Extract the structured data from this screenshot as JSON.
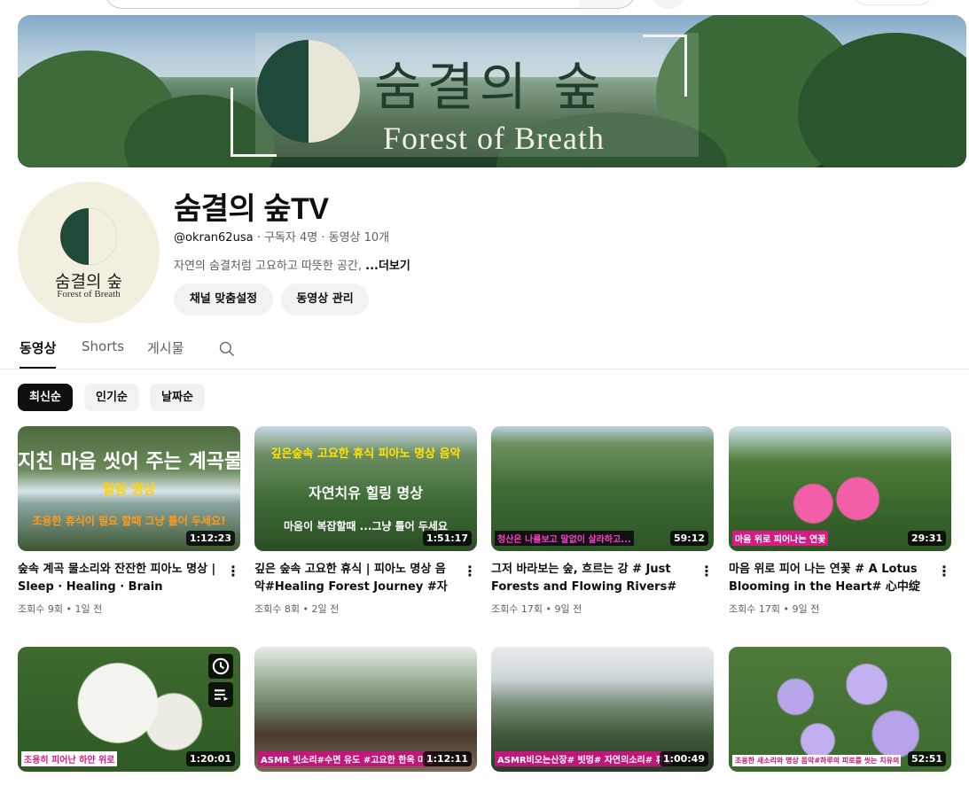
{
  "banner": {
    "title_ko": "숨결의 숲",
    "title_en": "Forest of Breath"
  },
  "avatar": {
    "title_ko": "숨결의 숲",
    "title_en": "Forest of Breath"
  },
  "channel": {
    "name": "숨결의 숲TV",
    "handle": "@okran62usa",
    "subscribers": "구독자 4명",
    "video_count": "동영상 10개",
    "sep": " · ",
    "description": "자연의 숨결처럼 고요하고 따뜻한 공간, ",
    "more": "...더보기",
    "customize_label": "채널 맞춤설정",
    "manage_label": "동영상 관리"
  },
  "tabs": [
    "동영상",
    "Shorts",
    "게시물"
  ],
  "chips": [
    "최신순",
    "인기순",
    "날짜순"
  ],
  "videos": [
    {
      "title": "숲속 계곡 물소리와 잔잔한 피아노 명상 | Sleep · Healing · Brain Relaxation…",
      "meta": "조회수 9회 • 1일 전",
      "duration": "1:12:23",
      "overlay": [
        "지친 마음 씻어 주는 계곡물",
        "힐링 명상",
        "조용한 휴식이 필요 할때 그냥 틀어 두세요!"
      ]
    },
    {
      "title": "깊은 숲속 고요한 휴식 | 피아노 명상 음악#Healing Forest Journey #자연풍…",
      "meta": "조회수 8회 • 2일 전",
      "duration": "1:51:17",
      "overlay": [
        "깊은숲속 고요한 휴식 피아노 명상 음악",
        "자연치유 힐링 명상",
        "마음이 복잡할때 ...그냥 틀어 두세요"
      ]
    },
    {
      "title": "그저 바라보는 숲, 흐르는 강 # Just Forests and Flowing Rivers# “只是…",
      "meta": "조회수 17회 • 9일 전",
      "duration": "59:12",
      "caption": "청산은 나를보고 말없이 살라하고..."
    },
    {
      "title": "마음 위로 피어 나는 연꽃 # A Lotus Blooming in the Heart# 心中绽放…",
      "meta": "조회수 17회 • 9일 전",
      "duration": "29:31",
      "caption": "마음 위로 피어나는 연꽃"
    },
    {
      "duration": "1:20:01",
      "caption": "조용히 피어난 하얀 위로"
    },
    {
      "duration": "1:12:11",
      "caption": "ASMR 빗소리#수면 유도 #고요한 한옥 마을 장독대"
    },
    {
      "duration": "1:00:49",
      "caption": "ASMR비오는산장# 빗멍# 자연의소리# 휴일엔 수면"
    },
    {
      "duration": "52:51",
      "caption": "조용한 새소리와 명상 음악#하루의 피로를 씻는 치유의 시간"
    }
  ],
  "colors": {
    "text": "#0f0f0f",
    "secondary": "#606060",
    "chip_bg": "#f2f2f2",
    "active_chip": "#0f0f0f"
  },
  "icons": [
    "search-icon",
    "more-vert-icon",
    "clock-icon",
    "queue-icon"
  ]
}
